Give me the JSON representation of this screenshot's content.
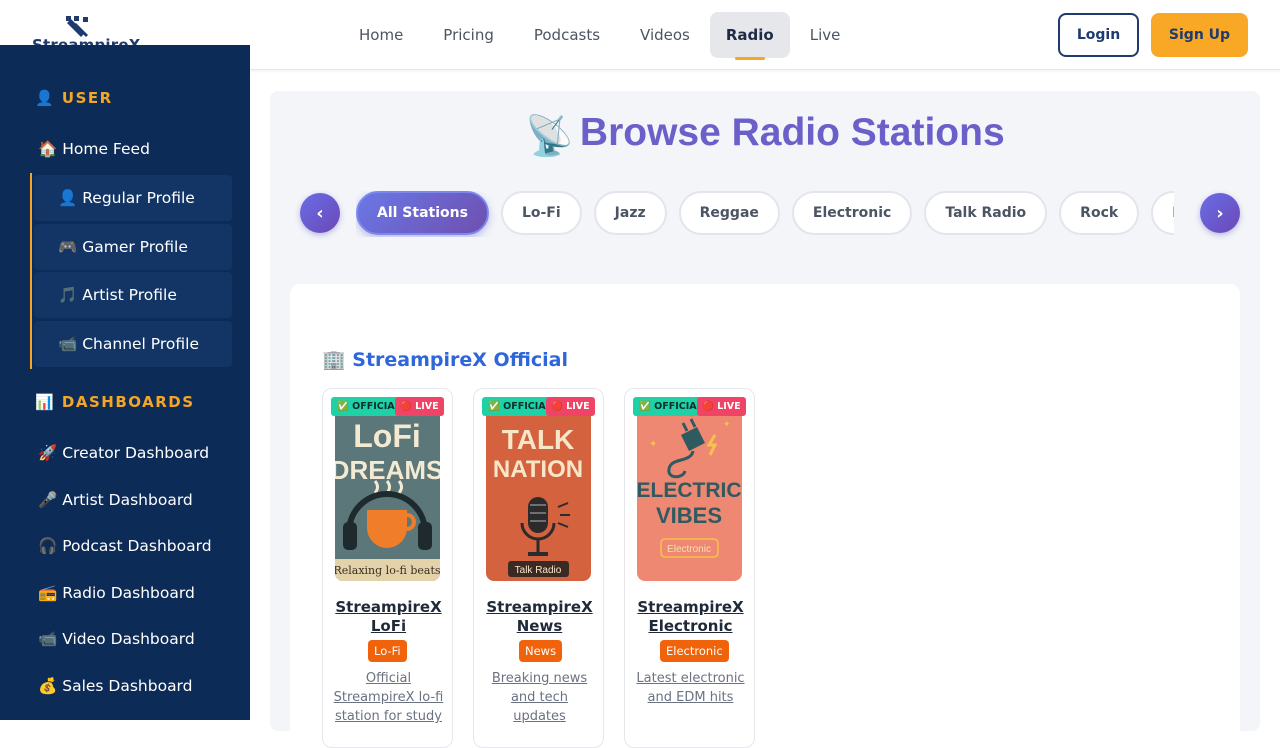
{
  "brand": {
    "name": "StreampireX"
  },
  "nav": {
    "links": [
      "Home",
      "Pricing",
      "Podcasts",
      "Videos",
      "Radio",
      "Live"
    ],
    "active": "Radio",
    "login_label": "Login",
    "signup_label": "Sign Up"
  },
  "sidebar": {
    "user_section": "👤 USER",
    "home_feed": "🏠 Home Feed",
    "profiles": [
      "👤 Regular Profile",
      "🎮 Gamer Profile",
      "🎵 Artist Profile",
      "📹 Channel Profile"
    ],
    "dashboards_section": "📊 DASHBOARDS",
    "dashboards": [
      "🚀 Creator Dashboard",
      "🎤 Artist Dashboard",
      "🎧 Podcast Dashboard",
      "📻 Radio Dashboard",
      "📹 Video Dashboard",
      "💰 Sales Dashboard"
    ]
  },
  "main": {
    "title": "Browse Radio Stations",
    "title_icon": "📡",
    "scroll_left": "‹",
    "scroll_right": "›",
    "categories": [
      "All Stations",
      "Lo-Fi",
      "Jazz",
      "Reggae",
      "Electronic",
      "Talk Radio",
      "Rock",
      "Hip Hop"
    ],
    "active_category": "All Stations",
    "section_title": "🏢 StreampireX Official",
    "badge_official": "✅ OFFICIAL",
    "badge_live": "🔴 LIVE",
    "stations": [
      {
        "name": "StreampireX LoFi",
        "genre": "Lo-Fi",
        "description": "Official StreampireX lo-fi station for study",
        "art": {
          "line1": "LoFi",
          "line2": "DREAMS",
          "caption": "Relaxing lo-fi beats",
          "bg": "#4f6b70"
        }
      },
      {
        "name": "StreampireX News",
        "genre": "News",
        "description": "Breaking news and tech updates",
        "art": {
          "line1": "TALK",
          "line2": "NATION",
          "caption": "Talk Radio",
          "bg": "#d4623e"
        }
      },
      {
        "name": "StreampireX Electronic",
        "genre": "Electronic",
        "description": "Latest electronic and EDM hits",
        "art": {
          "line1": "ELECTRIC",
          "line2": "VIBES",
          "caption": "Electronic",
          "bg": "#ee8872"
        }
      }
    ]
  },
  "colors": {
    "sidebar_bg": "#0d2b57",
    "accent": "#f5a623",
    "title": "#6b5fc9",
    "genre_badge": "#f0630a",
    "live_badge": "#ef4466",
    "official_badge": "#1fd1a7"
  }
}
